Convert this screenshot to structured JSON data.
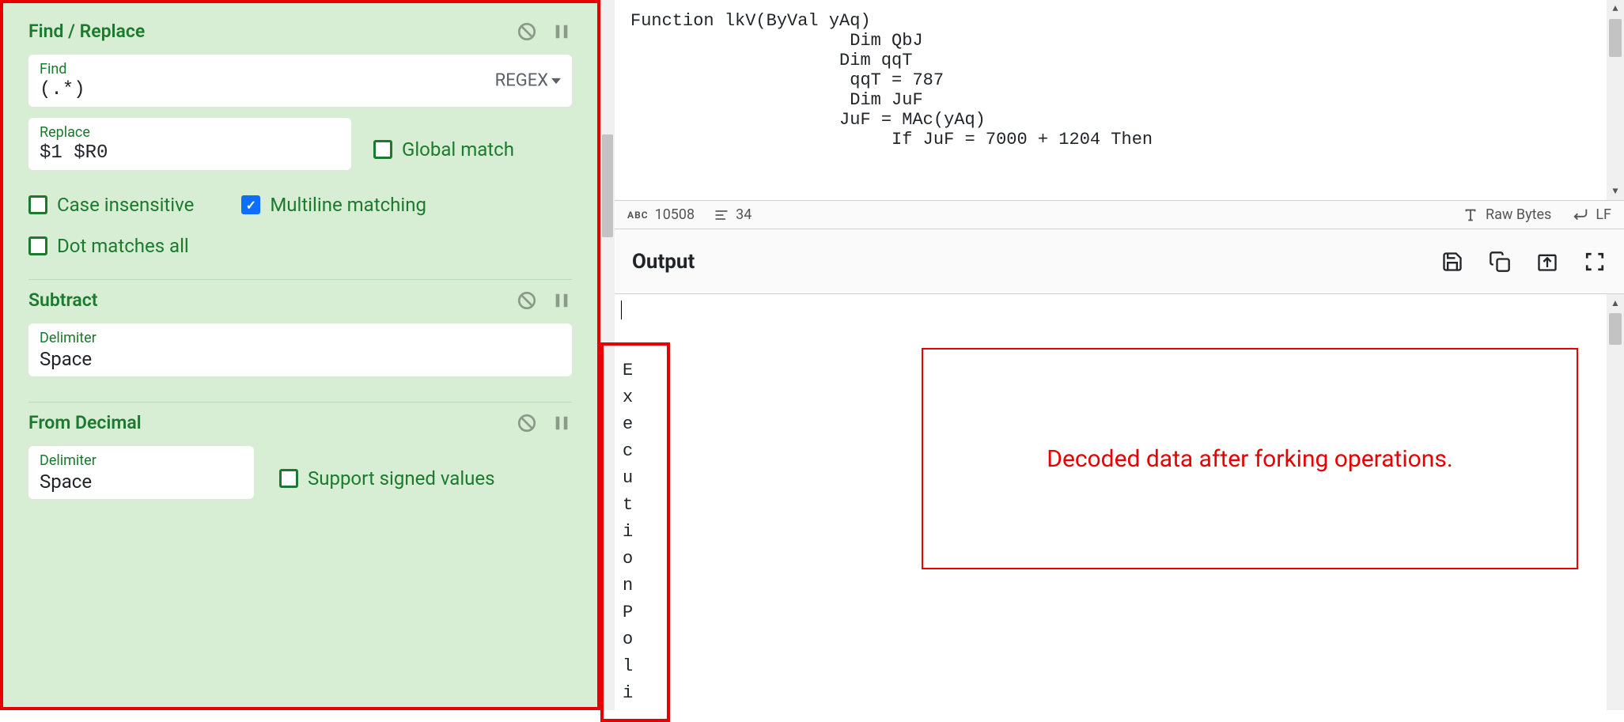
{
  "recipe": {
    "findReplace": {
      "title": "Find / Replace",
      "findLabel": "Find",
      "findValue": "(.*)",
      "regexTag": "REGEX",
      "replaceLabel": "Replace",
      "replaceValue": "$1 $R0",
      "globalMatch": {
        "label": "Global match",
        "checked": false
      },
      "caseInsensitive": {
        "label": "Case insensitive",
        "checked": false
      },
      "multiline": {
        "label": "Multiline matching",
        "checked": true
      },
      "dotAll": {
        "label": "Dot matches all",
        "checked": false
      }
    },
    "subtract": {
      "title": "Subtract",
      "delimiterLabel": "Delimiter",
      "delimiterValue": "Space"
    },
    "fromDecimal": {
      "title": "From Decimal",
      "delimiterLabel": "Delimiter",
      "delimiterValue": "Space",
      "signedLabel": "Support signed values",
      "signedChecked": false
    }
  },
  "input": {
    "code": "Function lkV(ByVal yAq)\n                     Dim QbJ\n                    Dim qqT\n                     qqT = 787\n                     Dim JuF\n                    JuF = MAc(yAq)\n                         If JuF = 7000 + 1204 Then"
  },
  "status": {
    "chars": "10508",
    "lines": "34",
    "rawBytes": "Raw Bytes",
    "lineEnding": "LF"
  },
  "output": {
    "title": "Output",
    "decodedChars": [
      "-",
      "E",
      "x",
      "e",
      "c",
      "u",
      "t",
      "i",
      "o",
      "n",
      "P",
      "o",
      "l",
      "i"
    ]
  },
  "annotation": "Decoded data after forking operations."
}
